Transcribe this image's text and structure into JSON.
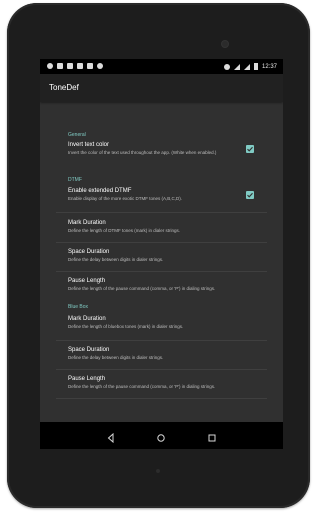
{
  "app": {
    "title": "ToneDef"
  },
  "status_bar": {
    "time": "12:37",
    "left_icons": [
      "notification-icon",
      "image-icon",
      "email-icon",
      "linkedin-icon",
      "photo-icon",
      "android-icon"
    ],
    "right_icons": [
      "alarm-icon",
      "wifi-icon",
      "signal-icon",
      "battery-icon"
    ]
  },
  "settings": {
    "sections": [
      {
        "header": "General",
        "items": [
          {
            "title": "Invert text color",
            "summary": "Invert the color of the text used throughout the app. (White when enabled.)",
            "checked": true
          }
        ]
      },
      {
        "header": "DTMF",
        "items": [
          {
            "title": "Enable extended DTMF",
            "summary": "Enable display of the more exotic DTMF tones (A,B,C,D).",
            "checked": true
          },
          {
            "title": "Mark Duration",
            "summary": "Define the length of DTMF tones (mark) in dialer strings."
          },
          {
            "title": "Space Duration",
            "summary": "Define the delay between digits in dialer strings."
          },
          {
            "title": "Pause Length",
            "summary": "Define the length of the pause command (comma, or 'P') in dialing strings."
          }
        ]
      },
      {
        "header": "Blue Box",
        "items": [
          {
            "title": "Mark Duration",
            "summary": "Define the length of bluebox tones (mark) in dialer strings."
          },
          {
            "title": "Space Duration",
            "summary": "Define the delay between digits in dialer strings."
          },
          {
            "title": "Pause Length",
            "summary": "Define the length of the pause command (comma, or 'P') in dialing strings."
          }
        ]
      }
    ]
  },
  "navigation": {
    "buttons": [
      "back-icon",
      "home-icon",
      "recents-icon"
    ]
  },
  "colors": {
    "accent": "#80cbc4",
    "background": "#303030",
    "appbar": "#212121"
  }
}
